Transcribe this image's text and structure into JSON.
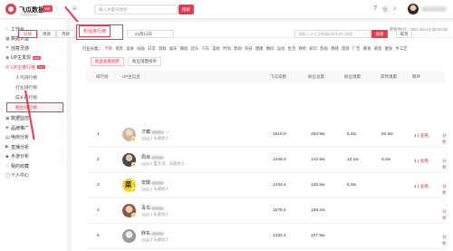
{
  "brand": {
    "name": "飞瓜数据",
    "badge": "B站",
    "sub": "飞瓜数据B站版"
  },
  "topbar": {
    "search_placeholder": "输入关键词搜索",
    "search_btn": "搜索",
    "icons": [
      "help-icon",
      "notice-icon",
      "bell-icon"
    ]
  },
  "sidebar": {
    "items": [
      {
        "label": "工作台",
        "icon": "home-icon"
      },
      {
        "label": "数据大盘",
        "icon": "chart-icon"
      },
      {
        "label": "创意灵感",
        "icon": "bulb-icon"
      },
      {
        "label": "UP主发现",
        "icon": "discover-icon",
        "badge": "NEW"
      },
      {
        "label": "UP主排行榜",
        "icon": "rank-icon",
        "badge": "NEW"
      }
    ],
    "sub_items": [
      "人气排行榜",
      "行业排行榜",
      "成长排行榜",
      "粉丝排行榜"
    ],
    "items_after": [
      {
        "label": "数据监控",
        "icon": "monitor-icon"
      },
      {
        "label": "品牌推广",
        "icon": "brand-icon"
      },
      {
        "label": "电商分析",
        "icon": "cart-icon"
      },
      {
        "label": "直播分析",
        "icon": "live-icon"
      },
      {
        "label": "手游分析",
        "icon": "game-icon"
      },
      {
        "label": "我的收藏",
        "icon": "star-icon"
      },
      {
        "label": "个人中心",
        "icon": "user-icon"
      }
    ]
  },
  "page": {
    "tab": "粉丝排行榜",
    "update_time": "更新时间：2021-04-13 05:00:00"
  },
  "filters": {
    "periods": [
      "日榜",
      "周榜",
      "月榜"
    ],
    "active_period": 0,
    "date": "04月12日",
    "search_placeholder": "请输入UP主名称或B站号进行搜索",
    "search_btn": "搜索",
    "cancel_btn": "取消",
    "industry_label": "行业分类：",
    "industries": [
      "不限",
      "搞笑",
      "美食",
      "动画",
      "日常",
      "游戏",
      "娱乐",
      "舞蹈",
      "音乐",
      "汽车",
      "美妆",
      "时尚",
      "影视",
      "科技",
      "健康",
      "数码",
      "运动",
      "生活",
      "财经",
      "知识",
      "影视",
      "情感",
      "旅游",
      "广告",
      "教育",
      "萌宠",
      "健身",
      "手工艺"
    ],
    "active_industry": 0,
    "subtypes": [
      "粉丝总量榜单",
      "粉丝增量榜单"
    ],
    "active_subtype": 0
  },
  "table": {
    "headers": [
      "排行榜",
      "UP主信息",
      "飞瓜指数",
      "粉丝总量",
      "粉丝增量",
      "获赞增量",
      "稿件",
      "操作"
    ],
    "rows": [
      {
        "rank": "1",
        "name": "才藏",
        "gender": "♂",
        "lv": "2",
        "tag": "头部达人",
        "index": "1510.0",
        "fans": "263.9w",
        "fans_inc": "5.4w",
        "likes": "92.5w",
        "works": "1",
        "view": "查看",
        "analyze": "分析",
        "fav": "收藏"
      },
      {
        "rank": "2",
        "name": "周目",
        "gender": "",
        "lv": "3",
        "tag": "官方号、头部达人",
        "index": "1448.0",
        "fans": "142.9w",
        "fans_inc": "12.1w",
        "likes": "6.2w",
        "works": "1",
        "view": "查看",
        "analyze": "分析",
        "fav": "收藏"
      },
      {
        "rank": "3",
        "name": "安徽",
        "gender": "",
        "lv": "5",
        "tag": "头部达人",
        "index": "1433.4",
        "fans": "136.8w",
        "fans_inc": "6.2w",
        "likes": "",
        "works": "1",
        "view": "查看",
        "analyze": "分析",
        "fav": "收藏"
      },
      {
        "rank": "4",
        "name": "青鸟",
        "gender": "",
        "lv": "3",
        "tag": "头部达人",
        "index": "1078.6",
        "fans": "108.2w",
        "fans_inc": "",
        "likes": "",
        "works": "",
        "view": "查看",
        "analyze": "分析",
        "fav": "收藏"
      },
      {
        "rank": "5",
        "name": "胖东",
        "gender": "",
        "lv": "2",
        "tag": "头部达人",
        "index": "1332.4",
        "fans": "107.9w",
        "fans_inc": "",
        "likes": "",
        "works": "",
        "view": "查看",
        "analyze": "分析",
        "fav": "收藏"
      }
    ]
  }
}
